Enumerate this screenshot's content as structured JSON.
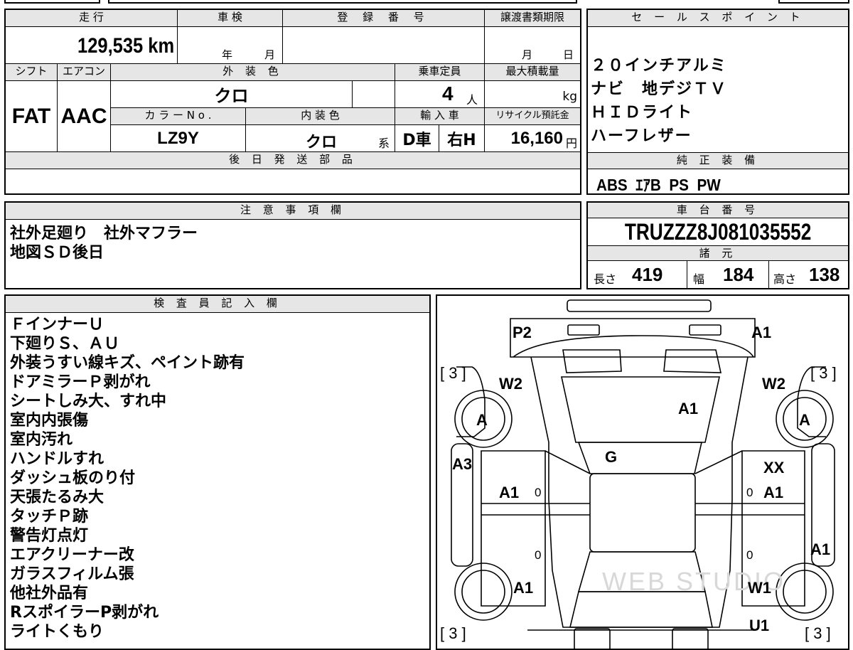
{
  "main": {
    "mileage_label": "走 行",
    "mileage_value": "129,535 km",
    "inspection_label": "車 検",
    "inspection_year": "年",
    "inspection_month": "月",
    "registration_label": "登 録 番 号",
    "transfer_label": "譲渡書類期限",
    "transfer_month": "月",
    "transfer_day": "日",
    "shift_label": "シフト",
    "shift_value": "FAT",
    "aircon_label": "エアコン",
    "aircon_value": "AAC",
    "exterior_label": "外 装 色",
    "exterior_value": "クロ",
    "capacity_label": "乗車定員",
    "capacity_value": "4",
    "capacity_unit": "人",
    "maxload_label": "最大積載量",
    "maxload_unit": "kg",
    "colorno_label": "カ ラ ー N o .",
    "colorno_value": "LZ9Y",
    "interior_label": "内 装 色",
    "interior_value": "クロ",
    "interior_suffix": "系",
    "import_label": "輸 入 車",
    "import_value": "D車",
    "handle_value": "右H",
    "recycle_label": "リサイクル預託金",
    "recycle_value": "16,160",
    "recycle_unit": "円",
    "later_parts_label": "後 日 発 送 部 品"
  },
  "sales": {
    "label": "セ ー ル ス ポ イ ン ト",
    "lines": [
      "２０インチアルミ",
      "ナビ　地デジＴＶ",
      "ＨＩＤライト",
      "ハーフレザー"
    ]
  },
  "equipment": {
    "label": "純 正 装 備",
    "value": "ABS  ｴｱB  PS  PW"
  },
  "notes": {
    "label": "注 意 事 項 欄",
    "lines": [
      "社外足廻り　社外マフラー",
      "地図ＳＤ後日"
    ]
  },
  "chassis": {
    "label": "車 台 番 号",
    "value": "TRUZZZ8J081035552",
    "specs_label": "諸 元",
    "length_label": "長さ",
    "length_value": "419",
    "width_label": "幅",
    "width_value": "184",
    "height_label": "高さ",
    "height_value": "138"
  },
  "inspector": {
    "label": "検 査 員 記 入 欄",
    "lines": [
      "ＦインナーＵ",
      "下廻りＳ、ＡＵ",
      "外装うすい線キズ、ペイント跡有",
      "ドアミラーＰ剥がれ",
      "シートしみ大、すれ中",
      "室内内張傷",
      "室内汚れ",
      "ハンドルすれ",
      "ダッシュ板のり付",
      "天張たるみ大",
      "タッチＰ跡",
      "警告灯点灯",
      "エアクリーナー改",
      "ガラスフィルム張",
      "他社外品有",
      "RスポイラーP剥がれ",
      "ライトくもり"
    ]
  },
  "diagram": {
    "marks": [
      "P2",
      "A1",
      "W2",
      "W2",
      "A1",
      "A",
      "A",
      "G",
      "A3",
      "XX",
      "A1",
      "A1",
      "A1",
      "A1",
      "W1",
      "U1"
    ],
    "brackets": [
      "[ 3 ]",
      "[ 3 ]",
      "[ 3 ]",
      "[ 3 ]"
    ],
    "zeros": [
      "0",
      "0",
      "0",
      "0"
    ],
    "watermark": "WEB STUDIO"
  }
}
